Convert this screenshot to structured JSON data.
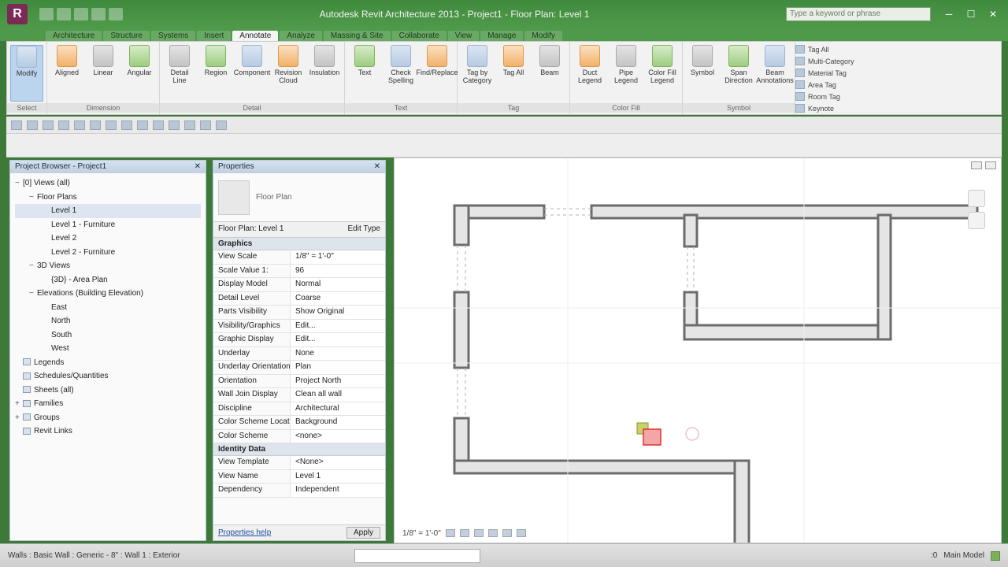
{
  "window": {
    "title": "Autodesk Revit Architecture 2013 - Project1 - Floor Plan: Level 1",
    "search_placeholder": "Type a keyword or phrase",
    "controls": [
      "─",
      "☐",
      "✕"
    ]
  },
  "ribbon": {
    "tabs": [
      "Architecture",
      "Structure",
      "Systems",
      "Insert",
      "Annotate",
      "Analyze",
      "Massing & Site",
      "Collaborate",
      "View",
      "Manage",
      "Modify"
    ],
    "active_tab": "Annotate",
    "panels": [
      {
        "label": "Select",
        "buttons": [
          {
            "label": "Modify",
            "icon": "cursor-icon"
          }
        ]
      },
      {
        "label": "Dimension",
        "buttons": [
          {
            "label": "Aligned",
            "icon": "aligned-dimension-icon"
          },
          {
            "label": "Linear",
            "icon": "linear-dimension-icon"
          },
          {
            "label": "Angular",
            "icon": "angular-dimension-icon"
          }
        ]
      },
      {
        "label": "Detail",
        "buttons": [
          {
            "label": "Detail Line",
            "icon": "detail-line-icon"
          },
          {
            "label": "Region",
            "icon": "region-icon"
          },
          {
            "label": "Component",
            "icon": "component-icon"
          },
          {
            "label": "Revision Cloud",
            "icon": "revision-cloud-icon"
          },
          {
            "label": "Insulation",
            "icon": "insulation-icon"
          }
        ]
      },
      {
        "label": "Text",
        "buttons": [
          {
            "label": "Text",
            "icon": "text-icon"
          },
          {
            "label": "Check Spelling",
            "icon": "spelling-icon"
          },
          {
            "label": "Find/Replace",
            "icon": "find-replace-icon"
          }
        ]
      },
      {
        "label": "Tag",
        "buttons": [
          {
            "label": "Tag by Category",
            "icon": "tag-icon"
          },
          {
            "label": "Tag All",
            "icon": "tag-all-icon"
          },
          {
            "label": "Beam",
            "icon": "beam-icon"
          }
        ]
      },
      {
        "label": "Color Fill",
        "buttons": [
          {
            "label": "Duct Legend",
            "icon": "legend-icon"
          },
          {
            "label": "Pipe Legend",
            "icon": "legend-icon"
          },
          {
            "label": "Color Fill Legend",
            "icon": "color-fill-icon"
          }
        ]
      },
      {
        "label": "Symbol",
        "buttons": [
          {
            "label": "Symbol",
            "icon": "symbol-icon"
          },
          {
            "label": "Span Direction",
            "icon": "span-icon"
          },
          {
            "label": "Beam Annotations",
            "icon": "beam-annotation-icon"
          }
        ]
      }
    ],
    "small_items": [
      "Tag All",
      "Multi-Category",
      "Material Tag",
      "Area Tag",
      "Room Tag",
      "Keynote"
    ]
  },
  "project_browser": {
    "title": "Project Browser - Project1",
    "items": [
      {
        "indent": 0,
        "toggle": "−",
        "label": "[0] Views (all)"
      },
      {
        "indent": 1,
        "toggle": "−",
        "label": "Floor Plans"
      },
      {
        "indent": 2,
        "toggle": "",
        "label": "Level 1",
        "selected": true
      },
      {
        "indent": 2,
        "toggle": "",
        "label": "Level 1 - Furniture"
      },
      {
        "indent": 2,
        "toggle": "",
        "label": "Level 2"
      },
      {
        "indent": 2,
        "toggle": "",
        "label": "Level 2 - Furniture"
      },
      {
        "indent": 1,
        "toggle": "−",
        "label": "3D Views"
      },
      {
        "indent": 2,
        "toggle": "",
        "label": "{3D} - Area Plan"
      },
      {
        "indent": 1,
        "toggle": "−",
        "label": "Elevations (Building Elevation)"
      },
      {
        "indent": 2,
        "toggle": "",
        "label": "East"
      },
      {
        "indent": 2,
        "toggle": "",
        "label": "North"
      },
      {
        "indent": 2,
        "toggle": "",
        "label": "South"
      },
      {
        "indent": 2,
        "toggle": "",
        "label": "West"
      },
      {
        "indent": 0,
        "toggle": "",
        "label": "Legends",
        "box": true
      },
      {
        "indent": 0,
        "toggle": "",
        "label": "Schedules/Quantities",
        "box": true
      },
      {
        "indent": 0,
        "toggle": "",
        "label": "Sheets (all)",
        "box": true
      },
      {
        "indent": 0,
        "toggle": "+",
        "label": "Families",
        "box": true
      },
      {
        "indent": 0,
        "toggle": "+",
        "label": "Groups",
        "box": true
      },
      {
        "indent": 0,
        "toggle": "",
        "label": "Revit Links",
        "box": true
      }
    ]
  },
  "properties": {
    "title": "Properties",
    "type_label": "Floor Plan",
    "filter_label": "Floor Plan: Level 1",
    "edit_type": "Edit Type",
    "group_graphics": "Graphics",
    "rows": [
      {
        "k": "View Scale",
        "v": "1/8\" = 1'-0\""
      },
      {
        "k": "Scale Value 1:",
        "v": "96"
      },
      {
        "k": "Display Model",
        "v": "Normal"
      },
      {
        "k": "Detail Level",
        "v": "Coarse"
      },
      {
        "k": "Parts Visibility",
        "v": "Show Original"
      },
      {
        "k": "Visibility/Graphics",
        "v": "Edit..."
      },
      {
        "k": "Graphic Display",
        "v": "Edit..."
      },
      {
        "k": "Underlay",
        "v": "None"
      },
      {
        "k": "Underlay Orientation",
        "v": "Plan"
      },
      {
        "k": "Orientation",
        "v": "Project North"
      },
      {
        "k": "Wall Join Display",
        "v": "Clean all wall"
      },
      {
        "k": "Discipline",
        "v": "Architectural"
      },
      {
        "k": "Color Scheme Location",
        "v": "Background"
      },
      {
        "k": "Color Scheme",
        "v": "<none>"
      }
    ],
    "group_identity": "Identity Data",
    "identity_rows": [
      {
        "k": "View Template",
        "v": "<None>"
      },
      {
        "k": "View Name",
        "v": "Level 1"
      },
      {
        "k": "Dependency",
        "v": "Independent"
      }
    ],
    "help_link": "Properties help",
    "apply": "Apply"
  },
  "view_control": {
    "scale": "1/8\" = 1'-0\""
  },
  "status": {
    "text": "Walls : Basic Wall : Generic - 8\" : Wall 1 : Exterior",
    "right": ":0",
    "model": "Main Model"
  },
  "colors": {
    "titlebar": "#4f9a4a",
    "ribbon_bg": "#f2f2f2",
    "wall": "#6b6b6b",
    "wall_fill": "#e5e5e5",
    "selection_red": "#e03030"
  }
}
